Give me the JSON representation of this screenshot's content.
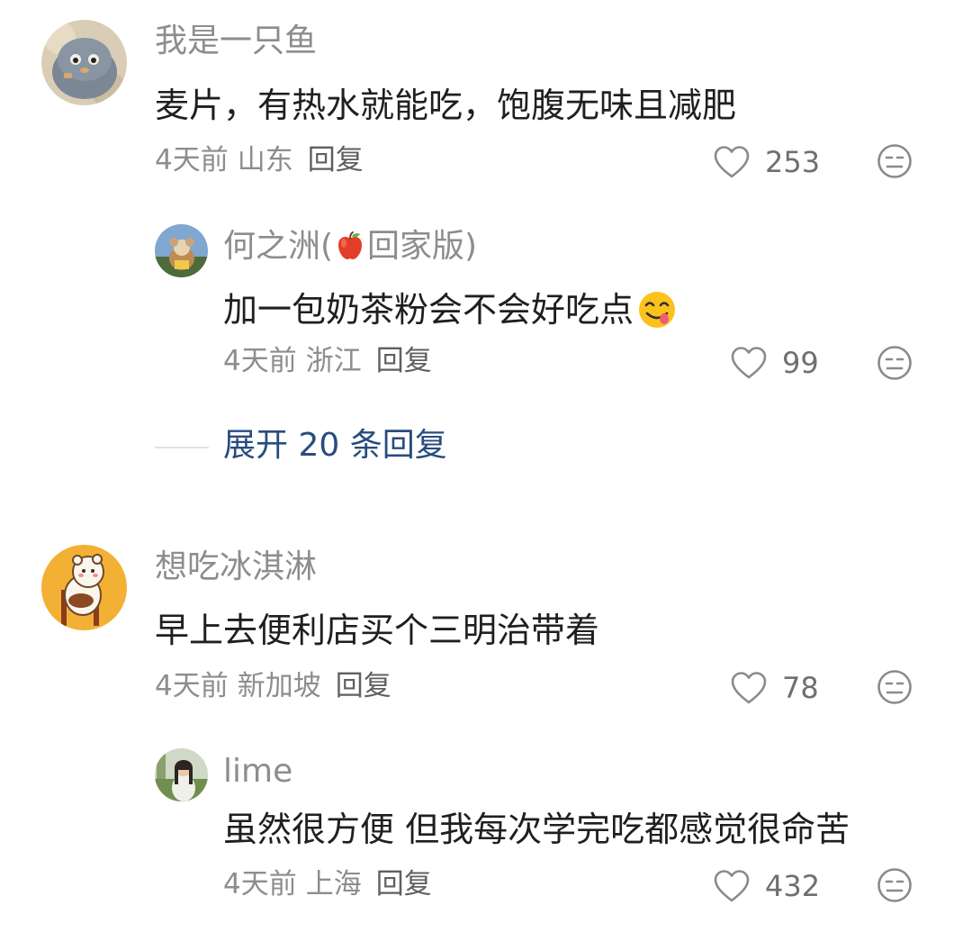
{
  "comments": [
    {
      "username": "我是一只鱼",
      "content": "麦片，有热水就能吃，饱腹无味且减肥",
      "time": "4天前",
      "location": "山东",
      "reply_label": "回复",
      "likes": "253",
      "avatar_icon": "fuzzy-blob-avatar",
      "replies": [
        {
          "username_prefix": "何之洲(",
          "username_suffix": "回家版)",
          "username_emoji": "red-apple-emoji",
          "content": "加一包奶茶粉会不会好吃点",
          "content_emoji": "yum-face-emoji",
          "time": "4天前",
          "location": "浙江",
          "reply_label": "回复",
          "likes": "99"
        }
      ],
      "expand_label": "展开 20 条回复"
    },
    {
      "username": "想吃冰淇淋",
      "content": "早上去便利店买个三明治带着",
      "time": "4天前",
      "location": "新加坡",
      "reply_label": "回复",
      "likes": "78",
      "avatar_icon": "cartoon-bear-avatar",
      "replies": [
        {
          "username": "lime",
          "content": "虽然很方便 但我每次学完吃都感觉很命苦",
          "time": "4天前",
          "location": "上海",
          "reply_label": "回复",
          "likes": "432"
        }
      ]
    }
  ],
  "colors": {
    "username": "#8d8d8d",
    "content": "#1f1f1f",
    "meta": "#8d8d8d",
    "expand_link": "#284c7e"
  }
}
